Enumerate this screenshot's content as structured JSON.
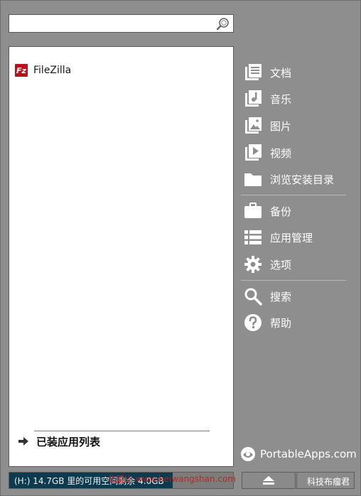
{
  "search": {
    "value": "",
    "placeholder": ""
  },
  "apps": [
    {
      "name": "FileZilla",
      "icon": "filezilla-icon",
      "badge": "Fz"
    }
  ],
  "installed_label": "已装应用列表",
  "menu": {
    "documents": "文档",
    "music": "音乐",
    "pictures": "图片",
    "videos": "视频",
    "browse": "浏览安装目录",
    "backup": "备份",
    "app_manage": "应用管理",
    "options": "选项",
    "search": "搜索",
    "help": "帮助"
  },
  "brand": "PortableApps.com",
  "status": {
    "text": "(H:) 14.7GB 里的可用空间剩余 4.0GB",
    "used_fraction": 0.73
  },
  "watermark": "北望山 www.beiwangshan.com",
  "corner_text": "科技布瘤君",
  "colors": {
    "background": "#8e8e8e",
    "status_fill": "#0c3a4e",
    "filezilla_red": "#b5151a"
  }
}
